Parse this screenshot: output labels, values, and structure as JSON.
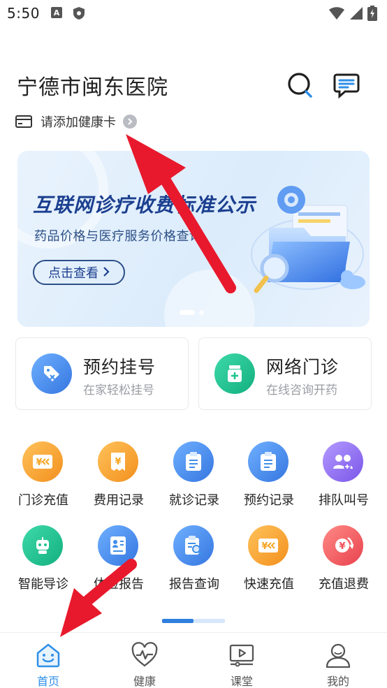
{
  "status_bar": {
    "time": "5:50"
  },
  "header": {
    "hospital_name": "宁德市闽东医院",
    "health_card_label": "请添加健康卡"
  },
  "banner": {
    "title": "互联网诊疗收费标准公示",
    "subtitle": "药品价格与医疗服务价格查询",
    "button_label": "点击查看",
    "page_count": 2,
    "active_page": 1
  },
  "features": [
    {
      "title": "预约挂号",
      "subtitle": "在家轻松挂号",
      "icon": "tag-icon",
      "color": "#3f8fea"
    },
    {
      "title": "网络门诊",
      "subtitle": "在线咨询开药",
      "icon": "medicine-icon",
      "color": "#1fc48f"
    }
  ],
  "services": [
    {
      "label": "门诊充值",
      "icon": "card-yen-icon",
      "color": "#f5a623"
    },
    {
      "label": "费用记录",
      "icon": "receipt-yen-icon",
      "color": "#f5a623"
    },
    {
      "label": "就诊记录",
      "icon": "clipboard-icon",
      "color": "#3f8fea"
    },
    {
      "label": "预约记录",
      "icon": "clipboard-icon",
      "color": "#3f8fea"
    },
    {
      "label": "排队叫号",
      "icon": "queue-people-icon",
      "color": "#8c6cf0"
    },
    {
      "label": "智能导诊",
      "icon": "robot-icon",
      "color": "#1fc48f"
    },
    {
      "label": "体检报告",
      "icon": "report-person-icon",
      "color": "#3f8fea"
    },
    {
      "label": "报告查询",
      "icon": "report-search-icon",
      "color": "#3f8fea"
    },
    {
      "label": "快速充值",
      "icon": "card-yen-icon",
      "color": "#f5a623"
    },
    {
      "label": "充值退费",
      "icon": "refund-yen-icon",
      "color": "#f0525c"
    }
  ],
  "bottom_nav": [
    {
      "label": "首页",
      "icon": "home-smile-icon",
      "active": true
    },
    {
      "label": "健康",
      "icon": "heart-pulse-icon",
      "active": false
    },
    {
      "label": "课堂",
      "icon": "video-class-icon",
      "active": false
    },
    {
      "label": "我的",
      "icon": "profile-icon",
      "active": false
    }
  ],
  "colors": {
    "accent": "#2f8fe8",
    "annotation_arrow": "#e8192c"
  }
}
